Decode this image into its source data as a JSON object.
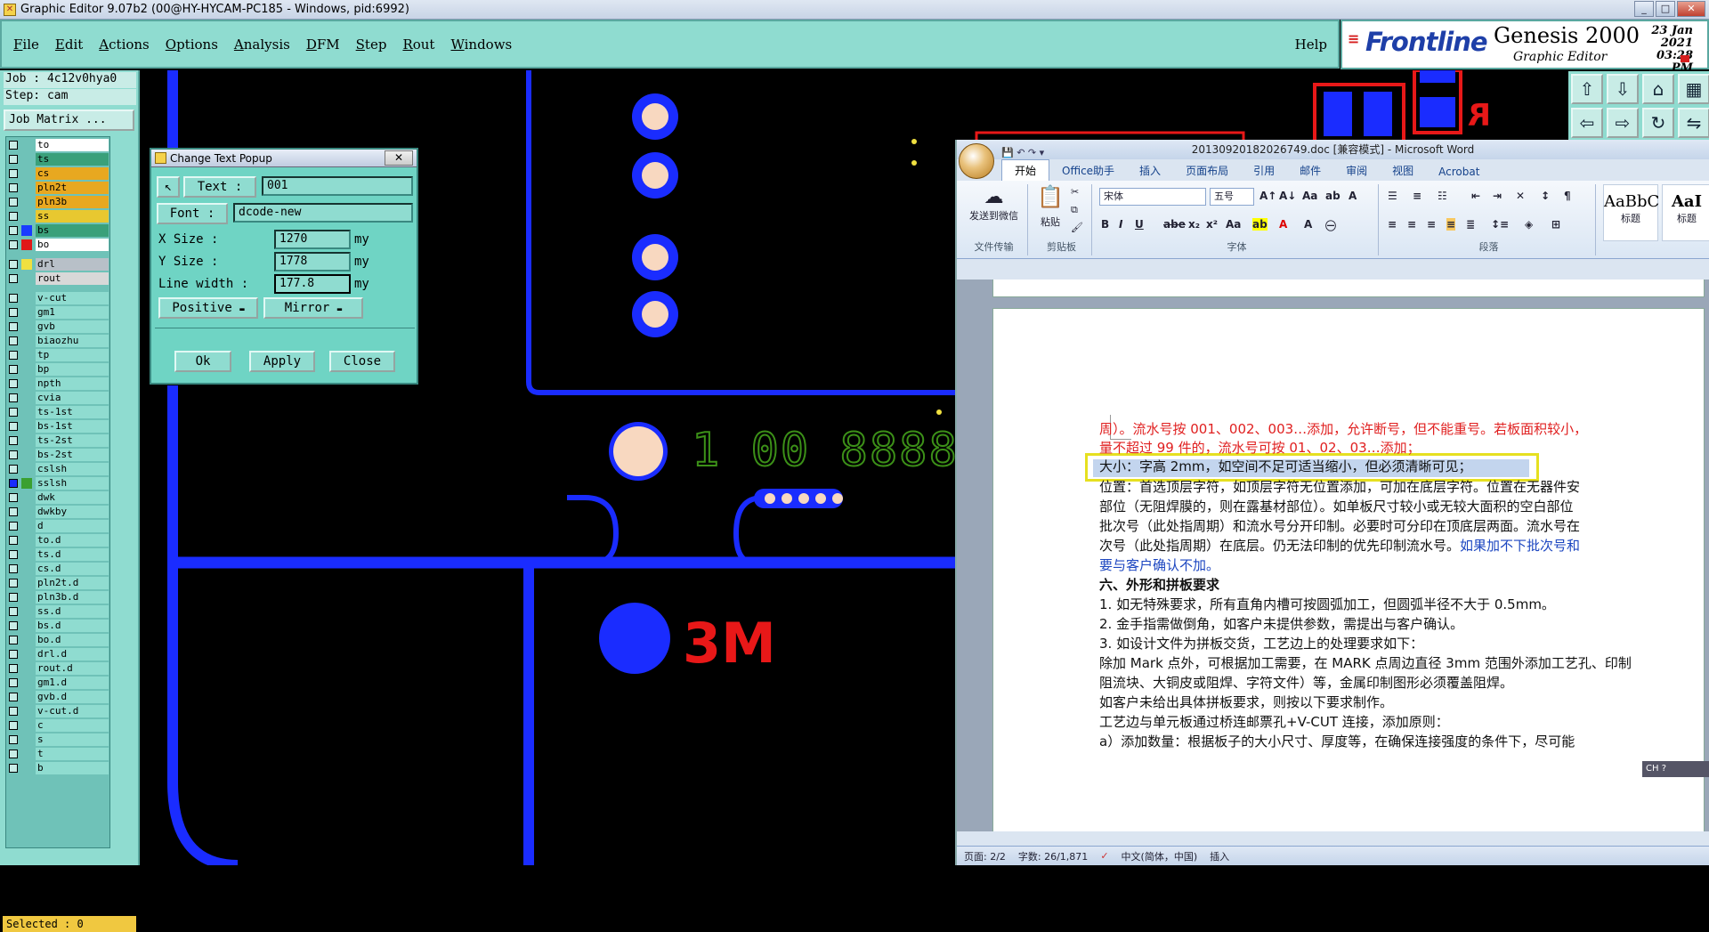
{
  "window": {
    "title": "Graphic Editor 9.07b2 (00@HY-HYCAM-PC185 - Windows, pid:6992)",
    "minimize": "_",
    "maximize": "□",
    "close": "✕"
  },
  "menu": [
    "File",
    "Edit",
    "Actions",
    "Options",
    "Analysis",
    "DFM",
    "Step",
    "Rout",
    "Windows"
  ],
  "help": "Help",
  "logo": {
    "brand": "Frontline",
    "product": "Genesis 2000",
    "sub": "Graphic Editor",
    "date": "23 Jan 2021",
    "time": "03:28 PM"
  },
  "job": {
    "job_line": "Job : 4c12v0hya0",
    "step_line": "Step: cam",
    "matrix_button": "Job Matrix ..."
  },
  "layers": [
    {
      "name": "to",
      "color": "#ffffff",
      "swatch": ""
    },
    {
      "name": "ts",
      "color": "#3aa07a",
      "swatch": ""
    },
    {
      "name": "cs",
      "color": "#e8a820",
      "swatch": ""
    },
    {
      "name": "pln2t",
      "color": "#e8a820",
      "swatch": ""
    },
    {
      "name": "pln3b",
      "color": "#e8a820",
      "swatch": ""
    },
    {
      "name": "ss",
      "color": "#e8c830",
      "swatch": ""
    },
    {
      "name": "bs",
      "color": "#3aa07a",
      "swatch": "#1a3cff"
    },
    {
      "name": "bo",
      "color": "#ffffff",
      "swatch": "#e01818"
    },
    {
      "name": "drl",
      "color": "#b8c0c8",
      "swatch": "#f0e040"
    },
    {
      "name": "rout",
      "color": "#d8d8d8",
      "swatch": ""
    },
    {
      "name": "v-cut",
      "color": "#8fdcd0",
      "swatch": ""
    },
    {
      "name": "gm1",
      "color": "#8fdcd0",
      "swatch": ""
    },
    {
      "name": "gvb",
      "color": "#8fdcd0",
      "swatch": ""
    },
    {
      "name": "biaozhu",
      "color": "#8fdcd0",
      "swatch": ""
    },
    {
      "name": "tp",
      "color": "#8fdcd0",
      "swatch": ""
    },
    {
      "name": "bp",
      "color": "#8fdcd0",
      "swatch": ""
    },
    {
      "name": "npth",
      "color": "#8fdcd0",
      "swatch": ""
    },
    {
      "name": "cvia",
      "color": "#8fdcd0",
      "swatch": ""
    },
    {
      "name": "ts-1st",
      "color": "#8fdcd0",
      "swatch": ""
    },
    {
      "name": "bs-1st",
      "color": "#8fdcd0",
      "swatch": ""
    },
    {
      "name": "ts-2st",
      "color": "#8fdcd0",
      "swatch": ""
    },
    {
      "name": "bs-2st",
      "color": "#8fdcd0",
      "swatch": ""
    },
    {
      "name": "cslsh",
      "color": "#8fdcd0",
      "swatch": ""
    },
    {
      "name": "sslsh",
      "color": "#8fdcd0",
      "swatch": "#3aa030"
    },
    {
      "name": "dwk",
      "color": "#8fdcd0",
      "swatch": ""
    },
    {
      "name": "dwkby",
      "color": "#8fdcd0",
      "swatch": ""
    },
    {
      "name": "d",
      "color": "#8fdcd0",
      "swatch": ""
    },
    {
      "name": "to.d",
      "color": "#8fdcd0",
      "swatch": ""
    },
    {
      "name": "ts.d",
      "color": "#8fdcd0",
      "swatch": ""
    },
    {
      "name": "cs.d",
      "color": "#8fdcd0",
      "swatch": ""
    },
    {
      "name": "pln2t.d",
      "color": "#8fdcd0",
      "swatch": ""
    },
    {
      "name": "pln3b.d",
      "color": "#8fdcd0",
      "swatch": ""
    },
    {
      "name": "ss.d",
      "color": "#8fdcd0",
      "swatch": ""
    },
    {
      "name": "bs.d",
      "color": "#8fdcd0",
      "swatch": ""
    },
    {
      "name": "bo.d",
      "color": "#8fdcd0",
      "swatch": ""
    },
    {
      "name": "drl.d",
      "color": "#8fdcd0",
      "swatch": ""
    },
    {
      "name": "rout.d",
      "color": "#8fdcd0",
      "swatch": ""
    },
    {
      "name": "gm1.d",
      "color": "#8fdcd0",
      "swatch": ""
    },
    {
      "name": "gvb.d",
      "color": "#8fdcd0",
      "swatch": ""
    },
    {
      "name": "v-cut.d",
      "color": "#8fdcd0",
      "swatch": ""
    },
    {
      "name": "c",
      "color": "#8fdcd0",
      "swatch": ""
    },
    {
      "name": "s",
      "color": "#8fdcd0",
      "swatch": ""
    },
    {
      "name": "t",
      "color": "#8fdcd0",
      "swatch": ""
    },
    {
      "name": "b",
      "color": "#8fdcd0",
      "swatch": ""
    }
  ],
  "selected": "Selected : 0",
  "canvas": {
    "digits": "1 00 8888",
    "silk": "3M"
  },
  "popup": {
    "title": "Change Text Popup",
    "close": "✕",
    "text_label": "Text :",
    "text_value": "001",
    "font_label": "Font :",
    "font_value": "dcode-new",
    "xsize_label": "X Size    :",
    "xsize_value": "1270",
    "ysize_label": "Y Size    :",
    "ysize_value": "1778",
    "lw_label": "Line width  :",
    "lw_value": "177.8",
    "unit": "my",
    "polarity": "Positive",
    "mirror": "Mirror",
    "ok": "Ok",
    "apply": "Apply",
    "close_btn": "Close"
  },
  "word": {
    "title": "20130920182026749.doc [兼容模式] - Microsoft Word",
    "tabs": [
      "开始",
      "Office助手",
      "插入",
      "页面布局",
      "引用",
      "邮件",
      "审阅",
      "视图",
      "Acrobat"
    ],
    "groups": {
      "g1": "发送到微信",
      "g1label": "文件传输",
      "paste": "粘贴",
      "clip": "剪贴板",
      "font": "字体",
      "para": "段落"
    },
    "font_name": "宋体",
    "font_size": "五号",
    "styles": [
      {
        "sample": "AaBbC",
        "name": "标题"
      },
      {
        "sample": "AaI",
        "name": "标题"
      }
    ],
    "lines": [
      {
        "text": "周）。流水号按 001、002、003…添加，允许断号，但不能重号。若板面积较小，",
        "style": "red"
      },
      {
        "text": "量不超过 99 件的，流水号可按 01、02、03…添加；",
        "style": "red"
      },
      {
        "text": "大小：字高 2mm，如空间不足可适当缩小，但必须清晰可见；",
        "style": ""
      },
      {
        "text": "位置：首选顶层字符，如顶层字符无位置添加，可加在底层字符。位置在无器件安",
        "style": ""
      },
      {
        "text": "部位（无阻焊膜的，则在露基材部位）。如单板尺寸较小或无较大面积的空白部位",
        "style": ""
      },
      {
        "text": "批次号（此处指周期）和流水号分开印制。必要时可分印在顶底层两面。流水号在",
        "style": ""
      },
      {
        "text": "次号（此处指周期）在底层。仍无法印制的优先印制流水号。如果加不下批次号和",
        "style": "mixed"
      },
      {
        "text": "要与客户确认不加。",
        "style": "blue"
      },
      {
        "text": "六、外形和拼板要求",
        "style": "bold"
      },
      {
        "text": "1. 如无特殊要求，所有直角内槽可按圆弧加工，但圆弧半径不大于 0.5mm。",
        "style": ""
      },
      {
        "text": "2. 金手指需做倒角，如客户未提供参数，需提出与客户确认。",
        "style": ""
      },
      {
        "text": "3. 如设计文件为拼板交货，工艺边上的处理要求如下：",
        "style": ""
      },
      {
        "text": "除加 Mark 点外，可根据加工需要，在 MARK 点周边直径 3mm 范围外添加工艺孔、印制",
        "style": ""
      },
      {
        "text": "阻流块、大铜皮或阻焊、字符文件）等，金属印制图形必须覆盖阻焊。",
        "style": ""
      },
      {
        "text": "如客户未给出具体拼板要求，则按以下要求制作。",
        "style": ""
      },
      {
        "text": "工艺边与单元板通过桥连邮票孔+V-CUT 连接，添加原则：",
        "style": ""
      },
      {
        "text": "a）添加数量：根据板子的大小尺寸、厚度等，在确保连接强度的条件下，尽可能",
        "style": ""
      }
    ],
    "mixed_black": "次号（此处指周期）在底层。仍无法印制的优先印制流水号。",
    "mixed_blue": "如果加不下批次号和",
    "status": {
      "page": "页面: 2/2",
      "words": "字数: 26/1,871",
      "lang": "中文(简体，中国)",
      "mode": "插入"
    },
    "ime": "CH"
  },
  "colors": {
    "blue": "#1a2cff",
    "red": "#e81818",
    "green": "#3c9018",
    "pad": "#f8d8c0"
  }
}
